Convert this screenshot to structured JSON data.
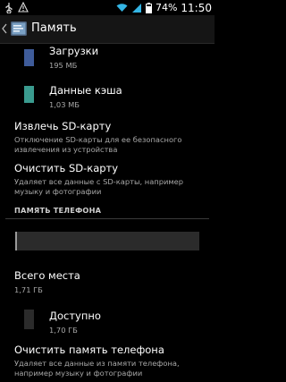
{
  "status_bar": {
    "battery_percent": "74%",
    "time": "11:50",
    "icons": [
      "usb-icon",
      "warning-icon",
      "wifi-icon",
      "signal-icon",
      "battery-icon"
    ]
  },
  "action_bar": {
    "title": "Память"
  },
  "items": {
    "downloads": {
      "label": "Загрузки",
      "value": "195 МБ",
      "color": "#3f5c9a"
    },
    "cache": {
      "label": "Данные кэша",
      "value": "1,03 МБ",
      "color": "#3a9b8f"
    },
    "unmount_sd": {
      "title": "Извлечь SD-карту",
      "summary": "Отключение SD-карты для ее безопасного извлечения из устройства"
    },
    "erase_sd": {
      "title": "Очистить SD-карту",
      "summary": "Удаляет все данные с SD-карты, например музыку и фотографии"
    },
    "phone_section_header": "ПАМЯТЬ ТЕЛЕФОНА",
    "storage_bar": {
      "used_fraction": 0.01,
      "used_color": "#9a9a9a",
      "free_color": "#2b2b2b"
    },
    "total": {
      "label": "Всего места",
      "value": "1,71 ГБ"
    },
    "available": {
      "label": "Доступно",
      "value": "1,70 ГБ",
      "color": "#2b2b2b"
    },
    "erase_phone": {
      "title": "Очистить память телефона",
      "summary": "Удаляет все данные из памяти телефона, например музыку и фотографии"
    }
  }
}
